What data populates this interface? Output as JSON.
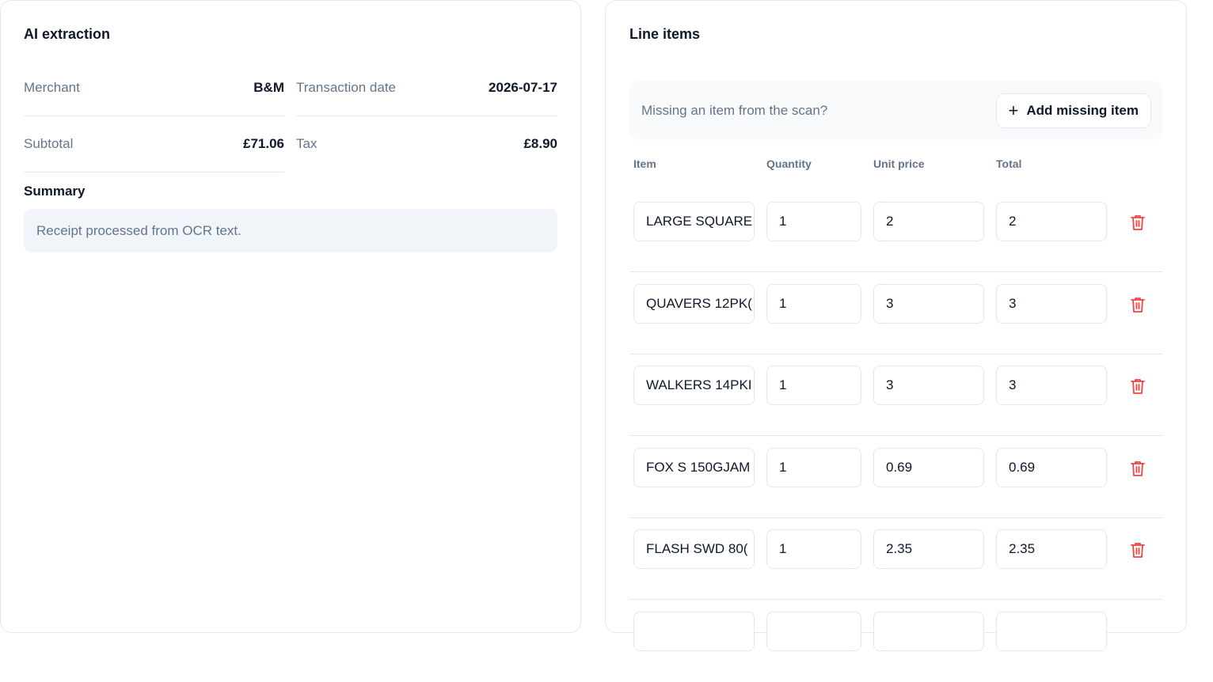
{
  "extraction": {
    "title": "AI extraction",
    "fields": {
      "merchant": {
        "label": "Merchant",
        "value": "B&M"
      },
      "transaction_date": {
        "label": "Transaction date",
        "value": "2026-07-17"
      },
      "subtotal": {
        "label": "Subtotal",
        "value": "£71.06"
      },
      "tax": {
        "label": "Tax",
        "value": "£8.90"
      }
    },
    "summary": {
      "title": "Summary",
      "text": "Receipt processed from OCR text."
    }
  },
  "line_items": {
    "title": "Line items",
    "missing_prompt": "Missing an item from the scan?",
    "add_button_label": "Add missing item",
    "columns": {
      "item": "Item",
      "quantity": "Quantity",
      "unit_price": "Unit price",
      "total": "Total"
    },
    "rows": [
      {
        "item": "LARGE SQUARE",
        "quantity": "1",
        "unit_price": "2",
        "total": "2"
      },
      {
        "item": "QUAVERS 12PK(",
        "quantity": "1",
        "unit_price": "3",
        "total": "3"
      },
      {
        "item": "WALKERS 14PKI",
        "quantity": "1",
        "unit_price": "3",
        "total": "3"
      },
      {
        "item": "FOX S 150GJAM",
        "quantity": "1",
        "unit_price": "0.69",
        "total": "0.69"
      },
      {
        "item": "FLASH SWD 80(",
        "quantity": "1",
        "unit_price": "2.35",
        "total": "2.35"
      }
    ]
  },
  "colors": {
    "accent_delete": "#ef4444"
  }
}
